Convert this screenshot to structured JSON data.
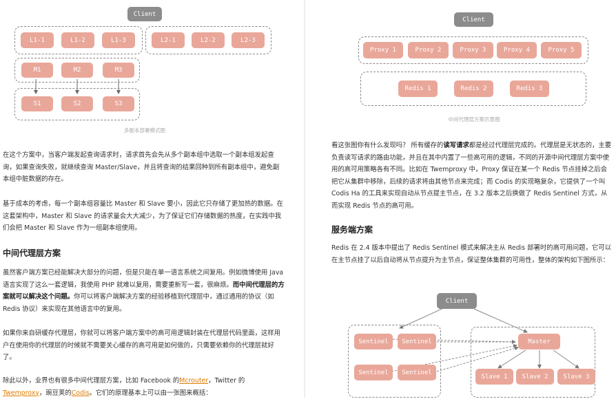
{
  "left_diagram": {
    "client": "Client",
    "group1": [
      "L1-1",
      "L1-2",
      "L1-3"
    ],
    "group2": [
      "L2-1",
      "L2-2",
      "L2-3"
    ],
    "masters": [
      "M1",
      "M2",
      "M3"
    ],
    "slaves": [
      "S1",
      "S2",
      "S3"
    ],
    "caption": "多副本部署模式图"
  },
  "left_text": {
    "p1": "在这个方案中，当客户端发起查询请求时，请求首先会先从多个副本组中选取一个副本组发起查询，如果查询失败，就继续查询 Master/Slave，并且将查询的结果回种到所有副本组中，避免副本组中脏数据的存在。",
    "p2": "基于成本的考虑，每一个副本组容量比 Master 和 Slave 要小，因此它只存储了更加热的数据。在这套架构中，Master 和 Slave 的请求量会大大减少，为了保证它们存储数据的热度，在实践中我们会把 Master 和 Slave 作为一组副本组使用。",
    "h1": "中间代理层方案",
    "p3a": "虽然客户端方案已经能解决大部分的问题，但是只能在单一语言系统之间复用。例如微博使用 Java 语言实现了这么一套逻辑，我使用 PHP 就难以复用，需要重新写一套，很麻烦。",
    "p3b": "而中间代理层的方案就可以解决这个问题。",
    "p3c": "你可以将客户端解决方案的经验移植到代理层中，通过通用的协议（如 Redis 协议）来实现在其他语言中的复用。",
    "p4a": "如果你来自研缓存代理层，你就可以将客户端方案中的高可用逻辑封装在代理层代码里面，这样用户在使用你的代理层的时候就不需要关心缓存的高可用是如何做的，只需要依赖你的",
    "p4b": "代理层就好了。",
    "p5a": "除此以外，业界也有很多中间代理层方案，比如 Facebook 的",
    "link1": "Mcrouter",
    "p5b": "，Twitter 的",
    "link2": "Twemproxy",
    "p5c": "，豌豆荚的",
    "link3": "Codis",
    "p5d": "。它们的原理基本上可以由一张图来概括："
  },
  "right_diagram1": {
    "client": "Client",
    "proxies": [
      "Proxy 1",
      "Proxy 2",
      "Proxy 3",
      "Proxy 4",
      "Proxy 5"
    ],
    "redis": [
      "Redis 1",
      "Redis 2",
      "Redis 3"
    ],
    "caption": "中间代理层方案示意图"
  },
  "right_text": {
    "p1a": "看这张图你有什么发现吗？ 所有缓存的",
    "p1b": "读写请求",
    "p1c": "都是经过代理层完成的。",
    "p1d": "代理层是无状态的，主要负责读写请求的路由功能，并且在其中内置了一些高可用的逻辑，不同的开源中间代理层方案中使用的高可用策略各有不同。比如在 Twemproxy 中，Proxy 保证在某一个 Redis 节点挂掉之后会把它从集群中移除，后续的请求将由其他节点来完成；而 Codis 的实现略复杂，它提供了一个叫 Codis Ha 的工具来实现自动从节点提主节点，在 3.2 版本之后换做了 Redis Sentinel 方式，从而实现 Redis 节点的高可用。",
    "h1": "服务端方案",
    "p2": "Redis 在 2.4 版本中提出了 Redis Sentinel 模式来解决主从 Redis 部署时的高可用问题，它可以在主节点挂了以后自动将从节点提升为主节点，保证整体集群的可用性，整体的架构如下图所示："
  },
  "right_diagram2": {
    "client": "Client",
    "sentinels": [
      "Sentinel",
      "Sentinel",
      "Sentinel",
      "Sentinel"
    ],
    "master": "Master",
    "slaves": [
      "Slave 1",
      "Slave 2",
      "Slave 3"
    ]
  }
}
